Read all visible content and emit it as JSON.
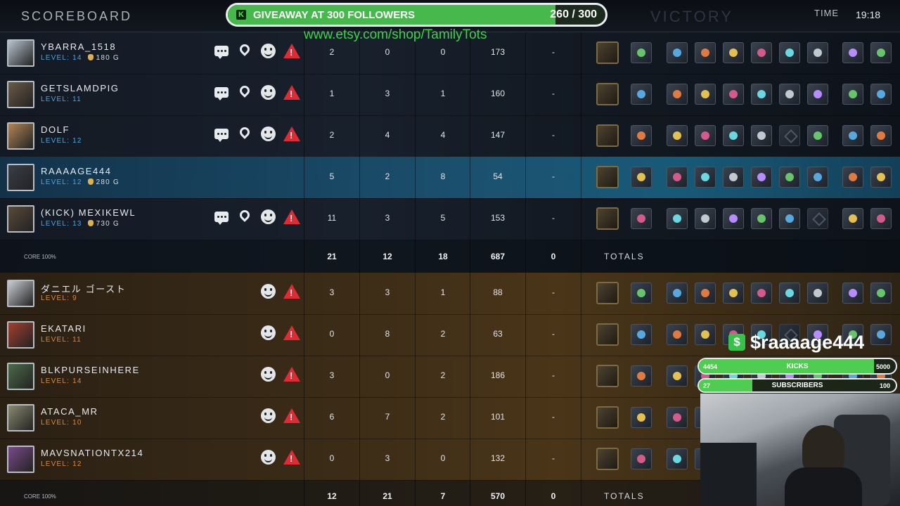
{
  "header": {
    "title": "SCOREBOARD",
    "result": "VICTORY",
    "time_label": "TIME",
    "time": "19:18"
  },
  "overlay": {
    "giveaway": {
      "text": "GIVEAWAY AT 300 FOLLOWERS",
      "count": "260 / 300",
      "progress": 0.867
    },
    "etsy": "www.etsy.com/shop/TamilyTots",
    "cashtag": "$raaaage444",
    "kicks": {
      "left": "4454",
      "label": "KICKS",
      "right": "5000",
      "progress": 0.891
    },
    "subs": {
      "left": "27",
      "label": "SUBSCRIBERS",
      "right": "100",
      "progress": 0.27
    }
  },
  "team1": {
    "players": [
      {
        "name": "YBARRA_1518",
        "level": "LEVEL: 14",
        "gold": "180 G",
        "stats": [
          "2",
          "0",
          "0",
          "173",
          "-"
        ],
        "social": true
      },
      {
        "name": "GETSLAMDPIG",
        "level": "LEVEL: 11",
        "gold": "",
        "stats": [
          "1",
          "3",
          "1",
          "160",
          "-"
        ],
        "social": true
      },
      {
        "name": "DOLF",
        "level": "LEVEL: 12",
        "gold": "",
        "stats": [
          "2",
          "4",
          "4",
          "147",
          "-"
        ],
        "social": true
      },
      {
        "name": "RAAAAGE444",
        "level": "LEVEL: 12",
        "gold": "280 G",
        "stats": [
          "5",
          "2",
          "8",
          "54",
          "-"
        ],
        "social": false
      },
      {
        "name": "(KICK) MEXIKEWL",
        "level": "LEVEL: 13",
        "gold": "730 G",
        "stats": [
          "11",
          "3",
          "5",
          "153",
          "-"
        ],
        "social": true
      }
    ],
    "totals": {
      "core": "CORE 100%",
      "values": [
        "21",
        "12",
        "18",
        "687",
        "0"
      ],
      "label": "TOTALS"
    }
  },
  "team2": {
    "players": [
      {
        "name": "ダニエル ゴースト",
        "level": "LEVEL: 9",
        "stats": [
          "3",
          "3",
          "1",
          "88",
          "-"
        ]
      },
      {
        "name": "EKATARI",
        "level": "LEVEL: 11",
        "stats": [
          "0",
          "8",
          "2",
          "63",
          "-"
        ]
      },
      {
        "name": "BLKPURSEINHERE",
        "level": "LEVEL: 14",
        "stats": [
          "3",
          "0",
          "2",
          "186",
          "-"
        ]
      },
      {
        "name": "ATACA_MR",
        "level": "LEVEL: 10",
        "stats": [
          "6",
          "7",
          "2",
          "101",
          "-"
        ]
      },
      {
        "name": "MAVSNATIONTX214",
        "level": "LEVEL: 12",
        "stats": [
          "0",
          "3",
          "0",
          "132",
          "-"
        ]
      }
    ],
    "totals": {
      "core": "CORE 100%",
      "values": [
        "12",
        "21",
        "7",
        "570",
        "0"
      ],
      "label": "TOTALS"
    }
  },
  "colors": {
    "accent_green": "#47b84c",
    "warn": "#e02b34",
    "level_ally": "#4aa5e0",
    "level_enemy": "#e0893a",
    "highlight_row": "#1b5270"
  }
}
